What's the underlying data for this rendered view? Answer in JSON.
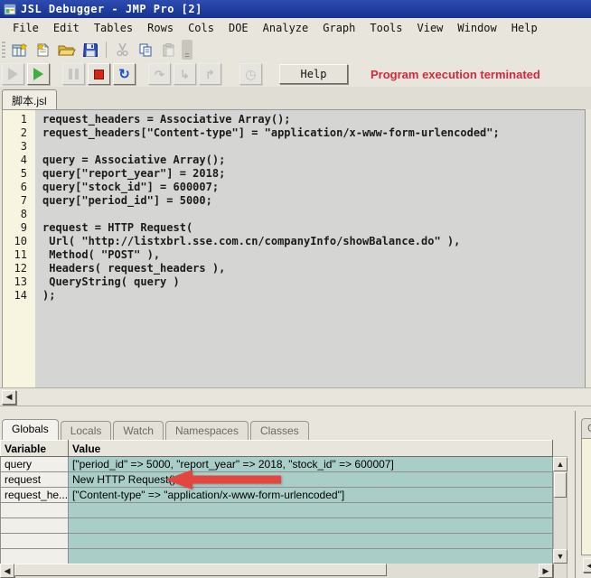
{
  "window": {
    "title": "JSL Debugger - JMP Pro [2]"
  },
  "menu": {
    "items": [
      "File",
      "Edit",
      "Tables",
      "Rows",
      "Cols",
      "DOE",
      "Analyze",
      "Graph",
      "Tools",
      "View",
      "Window",
      "Help"
    ]
  },
  "toolbar": {
    "icons": [
      "new-data-table-icon",
      "new-script-icon",
      "open-icon",
      "save-icon",
      "cut-icon",
      "copy-icon",
      "paste-icon",
      "toolbar-overflow-icon"
    ],
    "disabled_icons": [
      "cut-icon",
      "paste-icon"
    ]
  },
  "debug_toolbar": {
    "icons": [
      "run-disabled-icon",
      "run-icon",
      "pause-icon",
      "stop-icon",
      "reset-icon",
      "step-over-icon",
      "step-into-icon",
      "step-out-icon",
      "breakpoints-icon"
    ],
    "help_label": "Help",
    "status_text": "Program execution terminated",
    "status_color": "#d22a3b"
  },
  "editor": {
    "tab_label": "脚本.jsl",
    "lines": [
      "request_headers = Associative Array();",
      "request_headers[\"Content-type\"] = \"application/x-www-form-urlencoded\";",
      "",
      "query = Associative Array();",
      "query[\"report_year\"] = 2018;",
      "query[\"stock_id\"] = 600007;",
      "query[\"period_id\"] = 5000;",
      "",
      "request = HTTP Request(",
      " Url( \"http://listxbrl.sse.com.cn/companyInfo/showBalance.do\" ),",
      " Method( \"POST\" ),",
      " Headers( request_headers ),",
      " QueryString( query )",
      ");"
    ]
  },
  "inspector": {
    "tabs": [
      "Globals",
      "Locals",
      "Watch",
      "Namespaces",
      "Classes"
    ],
    "active_tab_index": 0,
    "columns": [
      "Variable",
      "Value"
    ],
    "rows": [
      {
        "variable": "query",
        "value": "[\"period_id\" => 5000, \"report_year\" => 2018, \"stock_id\" => 600007]"
      },
      {
        "variable": "request",
        "value": "New HTTP Request()"
      },
      {
        "variable": "request_he...",
        "value": "[\"Content-type\" => \"application/x-www-form-urlencoded\"]"
      }
    ],
    "empty_row_count": 4,
    "side_panel_partial_tab": "C"
  },
  "annotation": {
    "type": "red-arrow-left",
    "points_at_row": "request",
    "color": "#e2473f"
  },
  "colors": {
    "titlebar_blue": "#16328f",
    "value_cell_teal": "#a9cdc7",
    "gutter_cream": "#f7f4df",
    "editor_gray": "#d5d5d4"
  }
}
